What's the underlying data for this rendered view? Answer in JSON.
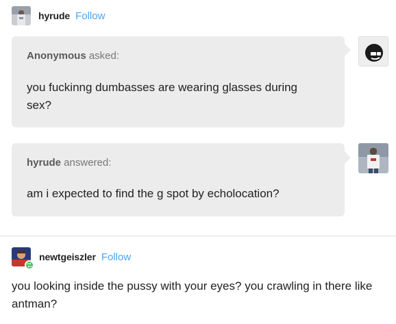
{
  "post": {
    "author": "hyrude",
    "follow_label": "Follow"
  },
  "ask": {
    "asker": "Anonymous",
    "asked_label": " asked:",
    "question": "you fuckinng dumbasses are wearing glasses during sex?"
  },
  "answer": {
    "answerer": "hyrude",
    "answered_label": " answered:",
    "text": "am i expected to find the g spot by echolocation?"
  },
  "reblog": {
    "author": "newtgeiszler",
    "follow_label": "Follow",
    "text": "you looking inside the pussy with your eyes? you crawling in there like antman?"
  },
  "colors": {
    "follow": "#4aa4f0",
    "bubble": "#ececec",
    "reblog_badge": "#35c45a"
  }
}
